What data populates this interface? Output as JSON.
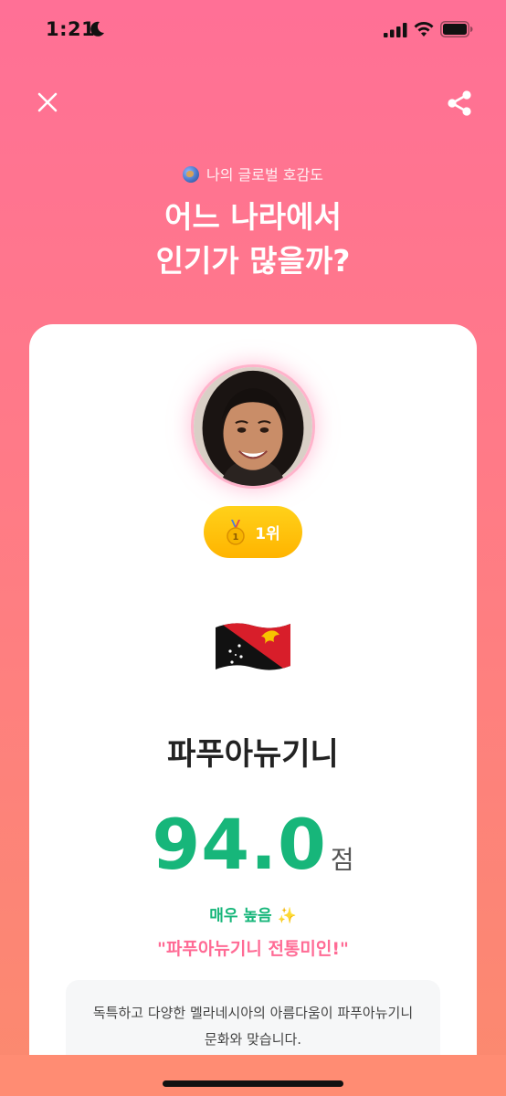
{
  "status_bar": {
    "time": "1:21"
  },
  "header": {
    "kicker": "나의 글로벌 호감도",
    "title_line1": "어느 나라에서",
    "title_line2": "인기가 많을까?"
  },
  "result": {
    "rank_label": "1위",
    "country": "파푸아뉴기니",
    "score": "94.0",
    "score_unit": "점",
    "level": "매우 높음 ✨",
    "quote": "\"파푸아뉴기니 전통미인!\"",
    "description": "독특하고 다양한 멜라네시아의 아름다움이 파푸아뉴기니 문화와 맞습니다."
  },
  "icons": {
    "close": "close-icon",
    "share": "share-icon",
    "globe": "globe-icon",
    "medal": "medal-icon",
    "flag": "papua-new-guinea-flag"
  },
  "colors": {
    "background_top": "#ff7096",
    "background_bottom": "#fb8a6e",
    "score_green": "#17b67a",
    "quote_pink": "#ff6b95",
    "rank_gold": "#ffc107"
  }
}
